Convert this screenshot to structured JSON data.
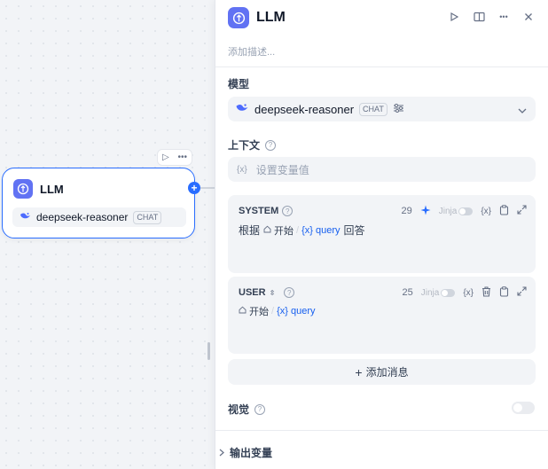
{
  "node": {
    "title": "LLM",
    "model_name": "deepseek-reasoner",
    "model_mode": "CHAT"
  },
  "panel": {
    "title": "LLM",
    "description_placeholder": "添加描述...",
    "model_section": {
      "label": "模型",
      "model_name": "deepseek-reasoner",
      "model_mode": "CHAT"
    },
    "context_section": {
      "label": "上下文",
      "var_icon": "{x}",
      "placeholder": "设置变量值"
    },
    "system_prompt": {
      "role": "SYSTEM",
      "count": "29",
      "jinja_label": "Jinja",
      "var_label": "{x}",
      "text_before": "根据",
      "var_start": "开始",
      "var_separator": "/",
      "var_name": "{x} query",
      "text_after": "回答"
    },
    "user_prompt": {
      "role": "USER",
      "count": "25",
      "jinja_label": "Jinja",
      "var_label": "{x}",
      "var_start": "开始",
      "var_separator": "/",
      "var_name": "{x} query"
    },
    "add_message_label": "添加消息",
    "vision_label": "视觉",
    "output_label": "输出变量"
  },
  "colors": {
    "accent": "#296dff",
    "llm_icon_bg": "#6172f3",
    "field_bg": "#f2f4f7"
  }
}
